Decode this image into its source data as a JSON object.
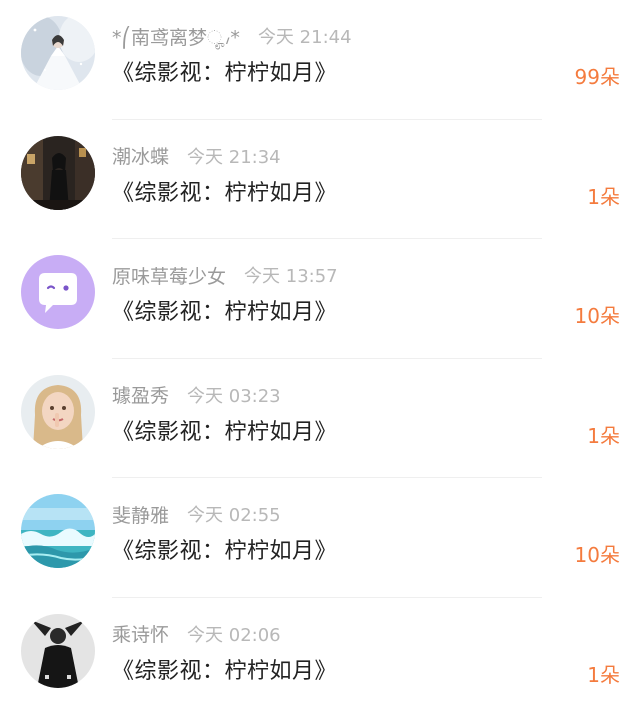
{
  "colors": {
    "count": "#f47b3e",
    "username": "#9a9a9a",
    "time": "#b8b8b8",
    "title": "#222222",
    "bubble_avatar_bg": "#c8adf5"
  },
  "items": [
    {
      "username": "*⎛南鸢离梦ೄ៸*",
      "time": "今天 21:44",
      "title": "《综影视：柠柠如月》",
      "count": "99朵",
      "avatar_icon": "snow-bride-avatar"
    },
    {
      "username": "潮冰蝶",
      "time": "今天 21:34",
      "title": "《综影视：柠柠如月》",
      "count": "1朵",
      "avatar_icon": "dark-street-avatar"
    },
    {
      "username": "原味草莓少女",
      "time": "今天 13:57",
      "title": "《综影视：柠柠如月》",
      "count": "10朵",
      "avatar_icon": "chat-bubble-avatar"
    },
    {
      "username": "璩盈秀",
      "time": "今天 03:23",
      "title": "《综影视：柠柠如月》",
      "count": "1朵",
      "avatar_icon": "girl-portrait-avatar"
    },
    {
      "username": "斐静雅",
      "time": "今天 02:55",
      "title": "《综影视：柠柠如月》",
      "count": "10朵",
      "avatar_icon": "ocean-wave-avatar"
    },
    {
      "username": "乘诗怀",
      "time": "今天 02:06",
      "title": "《综影视：柠柠如月》",
      "count": "1朵",
      "avatar_icon": "bw-figure-avatar"
    }
  ]
}
